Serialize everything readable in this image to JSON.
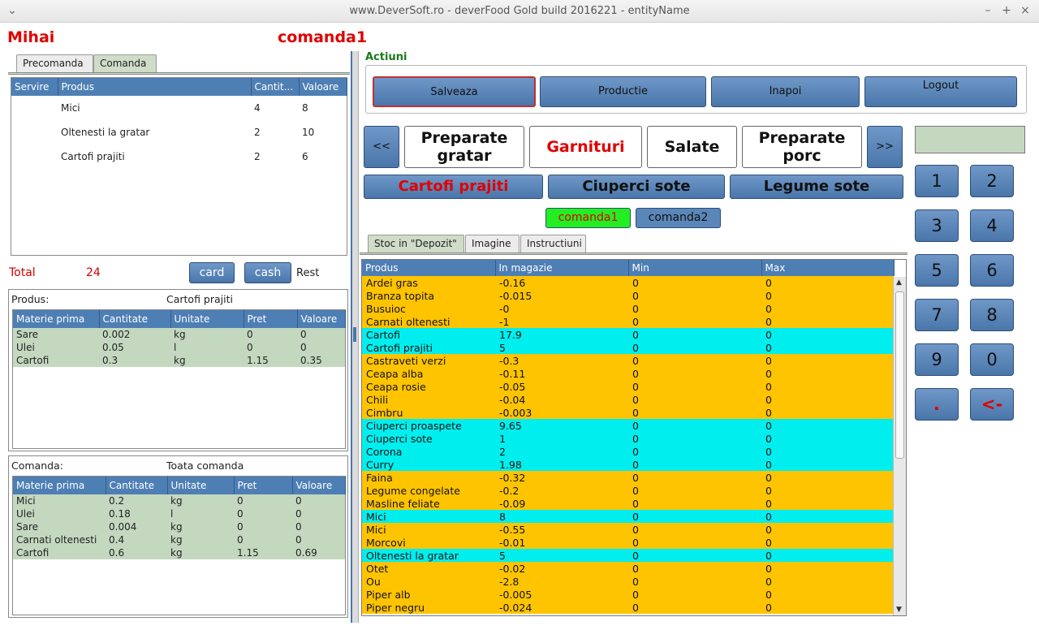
{
  "window": {
    "title": "www.DeverSoft.ro - deverFood Gold      build 2016221 - entityName"
  },
  "user": "Mihai",
  "order_name": "comanda1",
  "left_tabs": [
    "Precomanda",
    "Comanda"
  ],
  "order_table": {
    "columns": [
      "Servire",
      "Produs",
      "Cantit...",
      "Valoare"
    ],
    "rows": [
      {
        "servire": "",
        "produs": "Mici",
        "cant": "4",
        "val": "8"
      },
      {
        "servire": "",
        "produs": "Oltenesti la gratar",
        "cant": "2",
        "val": "10"
      },
      {
        "servire": "",
        "produs": "Cartofi prajiti",
        "cant": "2",
        "val": "6"
      }
    ]
  },
  "total": {
    "label": "Total",
    "value": "24",
    "card": "card",
    "cash": "cash",
    "rest": "Rest"
  },
  "product_panel": {
    "label": "Produs:",
    "value": "Cartofi prajiti",
    "columns": [
      "Materie prima",
      "Cantitate",
      "Unitate",
      "Pret",
      "Valoare"
    ],
    "rows": [
      [
        "Sare",
        "0.002",
        "kg",
        "0",
        "0"
      ],
      [
        "Ulei",
        "0.05",
        "l",
        "0",
        "0"
      ],
      [
        "Cartofi",
        "0.3",
        "kg",
        "1.15",
        "0.35"
      ]
    ]
  },
  "order_panel": {
    "label": "Comanda:",
    "value": "Toata comanda",
    "columns": [
      "Materie prima",
      "Cantitate",
      "Unitate",
      "Pret",
      "Valoare"
    ],
    "rows": [
      [
        "Mici",
        "0.2",
        "kg",
        "0",
        "0"
      ],
      [
        "Ulei",
        "0.18",
        "l",
        "0",
        "0"
      ],
      [
        "Sare",
        "0.004",
        "kg",
        "0",
        "0"
      ],
      [
        "Carnati oltenesti",
        "0.4",
        "kg",
        "0",
        "0"
      ],
      [
        "Cartofi",
        "0.6",
        "kg",
        "1.15",
        "0.69"
      ]
    ]
  },
  "actions": {
    "label": "Actiuni",
    "save": "Salveaza",
    "production": "Productie",
    "back": "Inapoi",
    "logout": "Logout"
  },
  "nav": {
    "prev": "<<",
    "next": ">>"
  },
  "categories": [
    {
      "line1": "Preparate",
      "line2": "gratar",
      "color": "#111111"
    },
    {
      "line1": "Garnituri",
      "line2": "",
      "color": "#e00000"
    },
    {
      "line1": "Salate",
      "line2": "",
      "color": "#111111"
    },
    {
      "line1": "Preparate",
      "line2": "porc",
      "color": "#111111"
    }
  ],
  "products": [
    {
      "label": "Cartofi prajiti",
      "color": "#e00000"
    },
    {
      "label": "Ciuperci sote",
      "color": "#111111"
    },
    {
      "label": "Legume sote",
      "color": "#111111"
    }
  ],
  "orders": [
    {
      "label": "comanda1",
      "bg": "#22ee22",
      "color": "#e00000"
    },
    {
      "label": "comanda2",
      "bg": "#5a86b8",
      "color": "#111111"
    }
  ],
  "stock_tabs": [
    "Stoc in \"Depozit\"",
    "Imagine",
    "Instructiuni"
  ],
  "stock": {
    "columns": [
      "Produs",
      "In magazie",
      "Min",
      "Max"
    ],
    "colors": {
      "negative": "#ffc400",
      "positive": "#00eeee"
    },
    "rows": [
      [
        "Ardei gras",
        "-0.16",
        "0",
        "0"
      ],
      [
        "Branza topita",
        "-0.015",
        "0",
        "0"
      ],
      [
        "Busuioc",
        "-0",
        "0",
        "0"
      ],
      [
        "Carnati oltenesti",
        "-1",
        "0",
        "0"
      ],
      [
        "Cartofi",
        "17.9",
        "0",
        "0"
      ],
      [
        "Cartofi prajiti",
        "5",
        "0",
        "0"
      ],
      [
        "Castraveti verzi",
        "-0.3",
        "0",
        "0"
      ],
      [
        "Ceapa alba",
        "-0.11",
        "0",
        "0"
      ],
      [
        "Ceapa rosie",
        "-0.05",
        "0",
        "0"
      ],
      [
        "Chili",
        "-0.04",
        "0",
        "0"
      ],
      [
        "Cimbru",
        "-0.003",
        "0",
        "0"
      ],
      [
        "Ciuperci proaspete",
        "9.65",
        "0",
        "0"
      ],
      [
        "Ciuperci sote",
        "1",
        "0",
        "0"
      ],
      [
        "Corona",
        "2",
        "0",
        "0"
      ],
      [
        "Curry",
        "1.98",
        "0",
        "0"
      ],
      [
        "Faina",
        "-0.32",
        "0",
        "0"
      ],
      [
        "Legume congelate",
        "-0.2",
        "0",
        "0"
      ],
      [
        "Masline feliate",
        "-0.09",
        "0",
        "0"
      ],
      [
        "Mici",
        "8",
        "0",
        "0"
      ],
      [
        "Mici",
        "-0.55",
        "0",
        "0"
      ],
      [
        "Morcovi",
        "-0.01",
        "0",
        "0"
      ],
      [
        "Oltenesti la gratar",
        "5",
        "0",
        "0"
      ],
      [
        "Otet",
        "-0.02",
        "0",
        "0"
      ],
      [
        "Ou",
        "-2.8",
        "0",
        "0"
      ],
      [
        "Piper alb",
        "-0.005",
        "0",
        "0"
      ],
      [
        "Piper negru",
        "-0.024",
        "0",
        "0"
      ]
    ]
  },
  "keypad": [
    "1",
    "2",
    "3",
    "4",
    "5",
    "6",
    "7",
    "8",
    "9",
    "0",
    ".",
    "<-"
  ]
}
